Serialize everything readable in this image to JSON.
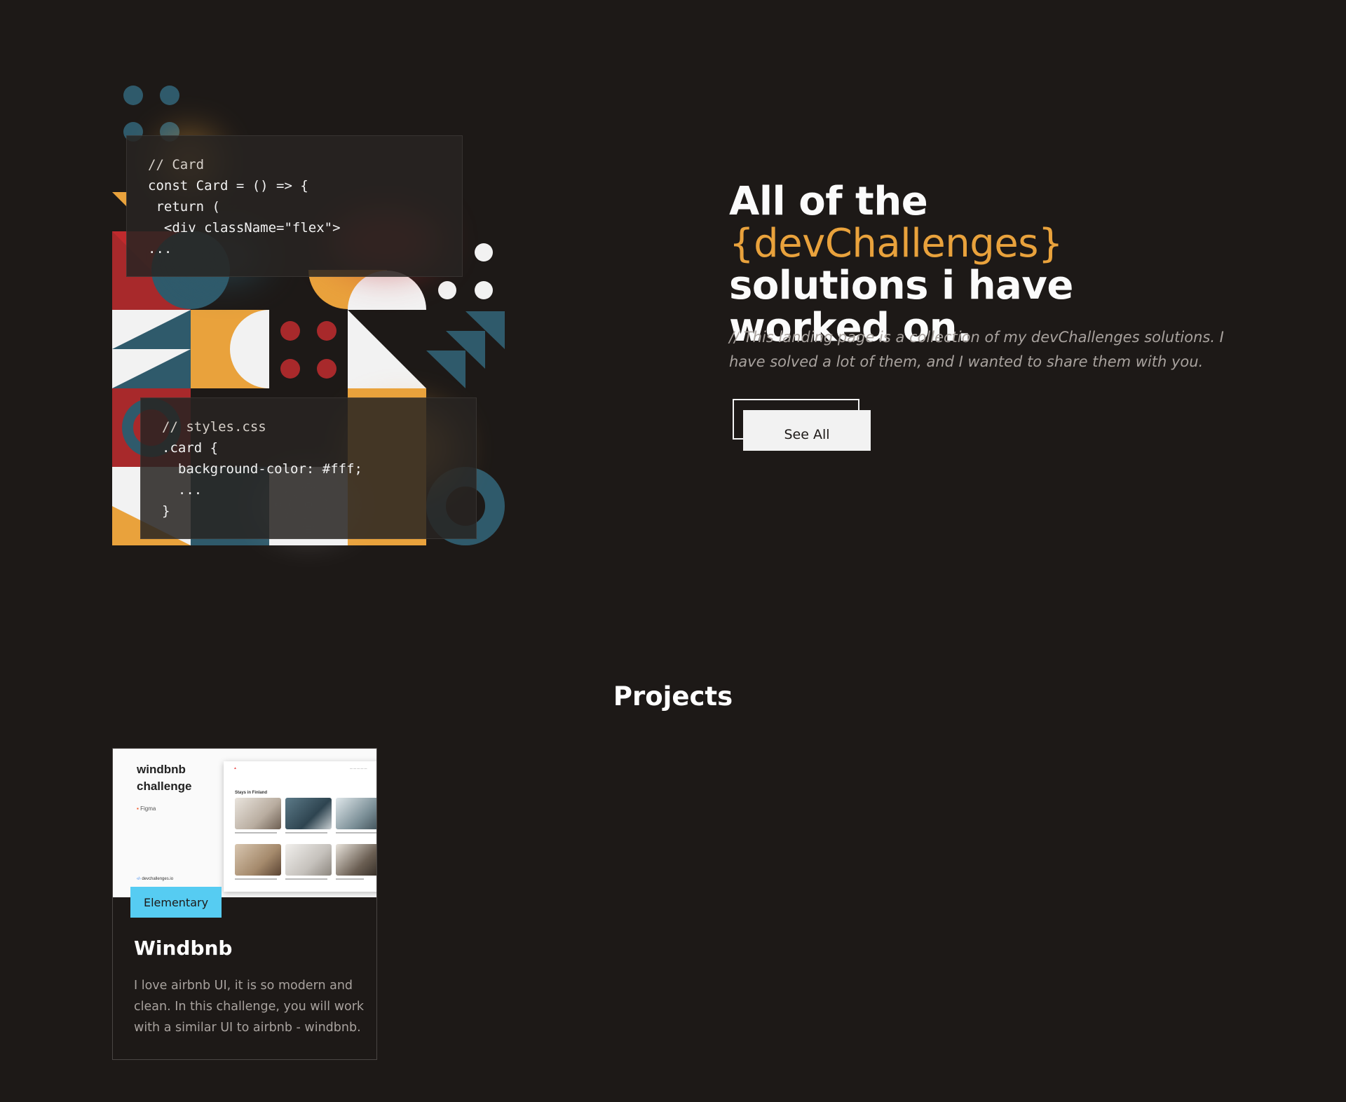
{
  "colors": {
    "background": "#1d1917",
    "accent": "#e9a23c",
    "teal": "#2f5a6b",
    "red": "#a8292b",
    "light": "#f2f2f2",
    "tag": "#56ccf2"
  },
  "code_card": {
    "lines": [
      "// Card",
      "const Card = () => {",
      " return (",
      "  <div className=\"flex\">",
      "..."
    ]
  },
  "styles_card": {
    "lines": [
      "// styles.css",
      ".card {",
      "  background-color: #fff;",
      "  ...",
      "}"
    ]
  },
  "hero": {
    "title_prefix": "All of the ",
    "title_accent": "{devChallenges}",
    "title_suffix": " solutions i have worked on.",
    "subtitle": "// This landing page is a collection of my devChallenges solutions. I have solved a lot of them, and I wanted to share them with you.",
    "button_label": "See All"
  },
  "projects": {
    "section_title": "Projects",
    "items": [
      {
        "thumb_title": "windbnb challenge",
        "thumb_tool": "Figma",
        "thumb_brand": "devchallenges.io",
        "thumb_heading": "Stays in Finland",
        "level": "Elementary",
        "title": "Windbnb",
        "description": "I love airbnb UI, it is so modern and clean. In this challenge, you will work with a similar UI to airbnb - windbnb."
      }
    ]
  }
}
